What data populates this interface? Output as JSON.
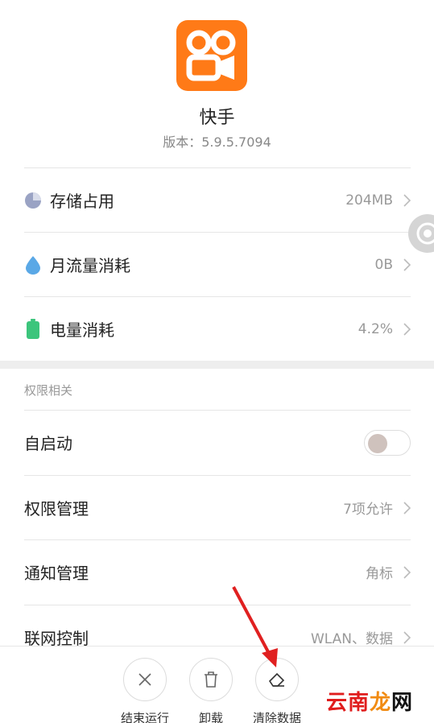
{
  "app": {
    "name": "快手",
    "version": "版本：5.9.5.7094",
    "icon": "kuaishou-app-icon",
    "brand_color": "#ff7a17"
  },
  "usage": [
    {
      "label": "存储占用",
      "value": "204MB",
      "icon": "storage-pie-icon",
      "color": "#9aa3c4"
    },
    {
      "label": "月流量消耗",
      "value": "0B",
      "icon": "water-drop-icon",
      "color": "#5aa8e6"
    },
    {
      "label": "电量消耗",
      "value": "4.2%",
      "icon": "battery-icon",
      "color": "#3cc57c"
    }
  ],
  "permissions_section": {
    "title": "权限相关",
    "autostart": {
      "label": "自启动",
      "enabled": false
    },
    "items": [
      {
        "label": "权限管理",
        "value": "7项允许"
      },
      {
        "label": "通知管理",
        "value": "角标"
      },
      {
        "label": "联网控制",
        "value": "WLAN、数据"
      }
    ]
  },
  "actions": [
    {
      "label": "结束运行",
      "icon": "close-icon"
    },
    {
      "label": "卸载",
      "icon": "trash-icon"
    },
    {
      "label": "清除数据",
      "icon": "eraser-icon"
    }
  ],
  "watermark": {
    "part1": "云南",
    "part2": "龙",
    "part3": "网"
  },
  "colors": {
    "accent_arrow": "#e02020",
    "separator": "#e6e6e6"
  }
}
